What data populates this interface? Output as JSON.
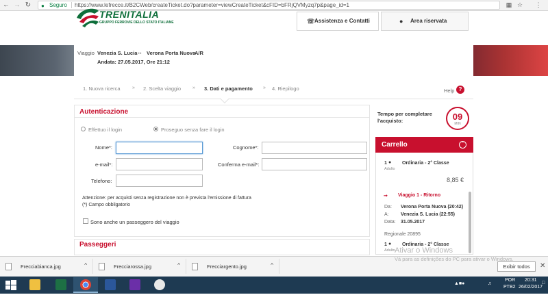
{
  "browser": {
    "secure_label": "Seguro",
    "url": "https://www.lefrecce.it/B2CWeb/createTicket.do?parameter=viewCreateTicket&cFID=bFRjQVMyzq7p&page_id=1",
    "icons": [
      "back-icon",
      "forward-icon",
      "reload-icon",
      "lock-icon",
      "translate-icon",
      "star-icon",
      "menu-icon"
    ]
  },
  "header": {
    "brand": "TRENITALIA",
    "brand_sub": "GRUPPO FERROVIE DELLO STATO ITALIANE",
    "assist_label": "Assistenza e Contatti",
    "area_label": "Area riservata"
  },
  "trip": {
    "viaggio_label": "Viaggio",
    "from": "Venezia S. Lucia",
    "to": "Verona Porta Nuova",
    "ar": "A/R",
    "andata": "Andata: 27.05.2017, Ore 21:12"
  },
  "steps": [
    "1. Nuova ricerca",
    "2. Scelta viaggio",
    "3. Dati e pagamento",
    "4. Riepilogo"
  ],
  "help_label": "Help",
  "auth": {
    "title": "Autenticazione",
    "option_login": "Effettuo il login",
    "option_guest": "Proseguo senza fare il login",
    "nome_label": "Nome*:",
    "cognome_label": "Cognome*:",
    "email_label": "e-mail*:",
    "confirm_email_label": "Conferma e-mail*:",
    "telefono_label": "Telefono:",
    "note1": "Attenzione: per acquisti senza registrazione non è prevista l'emissione di fattura",
    "note2": "(*) Campo obbligatorio",
    "passenger_check": "Sono anche un passeggero del viaggio",
    "nome_value": "",
    "cognome_value": "",
    "email_value": "",
    "confirm_email_value": "",
    "telefono_value": ""
  },
  "passeggeri_title": "Passeggeri",
  "timer": {
    "label": "Tempo per completare l'acquisto:",
    "value": "09",
    "unit": "MIN"
  },
  "cart": {
    "title": "Carrello",
    "item1_qty": "1",
    "item1_desc": "Ordinaria - 2° Classe",
    "item1_sub": "Adulto",
    "price": "8,85 €",
    "trip_title": "Viaggio 1 - Ritorno",
    "da_label": "Da:",
    "da_value": "Verona Porta Nuova (20:42)",
    "a_label": "A:",
    "a_value": "Venezia S. Lucia (22:55)",
    "data_label": "Data:",
    "data_value": "31.05.2017",
    "train": "Regionale  20895",
    "item2_qty": "1",
    "item2_desc": "Ordinaria - 2° Classe",
    "item2_sub": "Adulto"
  },
  "downloads": {
    "files": [
      "Frecciabianca.jpg",
      "Frecciarossa.jpg",
      "Frecciargento.jpg"
    ],
    "show_all": "Exibir todos",
    "watermark1": "Ativar o Windows",
    "watermark2": "Vá para as definições do PC para ativar o Windows."
  },
  "taskbar": {
    "lang1": "POR",
    "lang2": "PTB2",
    "time": "20:31",
    "date": "26/02/2017",
    "apps": [
      "file-explorer-icon",
      "excel-icon",
      "chrome-icon",
      "word-icon",
      "search-app-icon",
      "paint-icon"
    ]
  },
  "colors": {
    "accent_red": "#c8102e",
    "brand_green": "#0e6e3a",
    "taskbar": "#1e3a52"
  }
}
